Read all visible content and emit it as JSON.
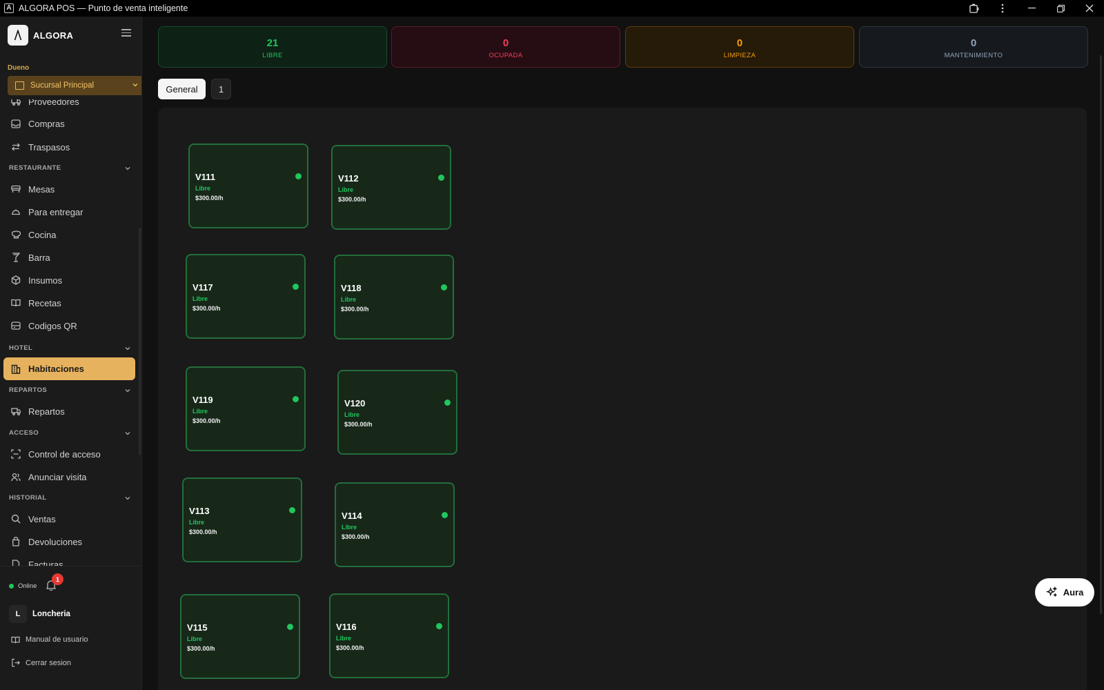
{
  "window": {
    "title": "ALGORA POS — Punto de venta inteligente",
    "logo_letter": "A"
  },
  "sidebar": {
    "brand": "ALGORA",
    "role": "Dueno",
    "branch": "Sucursal Principal",
    "items": {
      "proveedores": "Proveedores",
      "compras": "Compras",
      "traspasos": "Traspasos",
      "mesas": "Mesas",
      "para_entregar": "Para entregar",
      "cocina": "Cocina",
      "barra": "Barra",
      "insumos": "Insumos",
      "recetas": "Recetas",
      "codigos_qr": "Codigos QR",
      "habitaciones": "Habitaciones",
      "repartos": "Repartos",
      "control_acceso": "Control de acceso",
      "anunciar_visita": "Anunciar visita",
      "ventas": "Ventas",
      "devoluciones": "Devoluciones",
      "facturas": "Facturas"
    },
    "sections": {
      "restaurante": "RESTAURANTE",
      "hotel": "HOTEL",
      "repartos": "REPARTOS",
      "acceso": "ACCESO",
      "historial": "HISTORIAL"
    },
    "status": "Online",
    "notifications": "1",
    "user_initial": "L",
    "user_name": "Loncheria",
    "manual": "Manual de usuario",
    "logout": "Cerrar sesion"
  },
  "stats": {
    "libre": {
      "count": "21",
      "label": "LIBRE"
    },
    "ocupada": {
      "count": "0",
      "label": "OCUPADA"
    },
    "limpieza": {
      "count": "0",
      "label": "LIMPIEZA"
    },
    "mantenimiento": {
      "count": "0",
      "label": "MANTENIMIENTO"
    }
  },
  "tabs": {
    "general": "General",
    "floor_1": "1"
  },
  "rooms": [
    {
      "name": "V111",
      "status": "Libre",
      "price": "$300.00/h"
    },
    {
      "name": "V112",
      "status": "Libre",
      "price": "$300.00/h"
    },
    {
      "name": "V117",
      "status": "Libre",
      "price": "$300.00/h"
    },
    {
      "name": "V118",
      "status": "Libre",
      "price": "$300.00/h"
    },
    {
      "name": "V119",
      "status": "Libre",
      "price": "$300.00/h"
    },
    {
      "name": "V120",
      "status": "Libre",
      "price": "$300.00/h"
    },
    {
      "name": "V113",
      "status": "Libre",
      "price": "$300.00/h"
    },
    {
      "name": "V114",
      "status": "Libre",
      "price": "$300.00/h"
    },
    {
      "name": "V115",
      "status": "Libre",
      "price": "$300.00/h"
    },
    {
      "name": "V116",
      "status": "Libre",
      "price": "$300.00/h"
    }
  ],
  "aura_button": "Aura",
  "colors": {
    "accent": "#e7b25e",
    "libre": "#22c55e",
    "ocupada": "#f43f5e",
    "limpieza": "#f59e0b",
    "mantenimiento": "#94a3b8"
  }
}
